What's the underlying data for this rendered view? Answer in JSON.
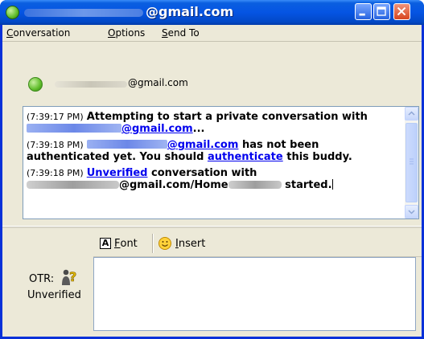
{
  "window": {
    "title_suffix": "@gmail.com"
  },
  "menu": {
    "conversation": {
      "first": "C",
      "rest": "onversation"
    },
    "options": {
      "first": "O",
      "rest": "ptions"
    },
    "send_to": {
      "first": "S",
      "rest": "end To"
    }
  },
  "buddy": {
    "name_suffix": "@gmail.com",
    "status_color": "#5fbd2a"
  },
  "log": {
    "messages": [
      {
        "time": "(7:39:17 PM)",
        "text1": "Attempting to start a private conversation with",
        "link_suffix": "@gmail.com",
        "text2": "..."
      },
      {
        "time": "(7:39:18 PM)",
        "link_suffix": "@gmail.com",
        "text1": " has not been authenticated yet.  You should ",
        "link2": "authenticate",
        "text2": " this buddy."
      },
      {
        "time": "(7:39:18 PM)",
        "link": "Unverified",
        "text1": " conversation with",
        "mid": "@gmail.com/Home",
        "text2": " started."
      }
    ]
  },
  "otr": {
    "label": "OTR:",
    "status": "Unverified",
    "icon": "otr-unverified-icon"
  },
  "toolbar": {
    "font": {
      "first": "F",
      "rest": "ont"
    },
    "insert": {
      "first": "I",
      "rest": "nsert"
    }
  },
  "colors": {
    "titlebar": "#0554e3",
    "link": "#0000ee",
    "chrome": "#ece9d8"
  }
}
